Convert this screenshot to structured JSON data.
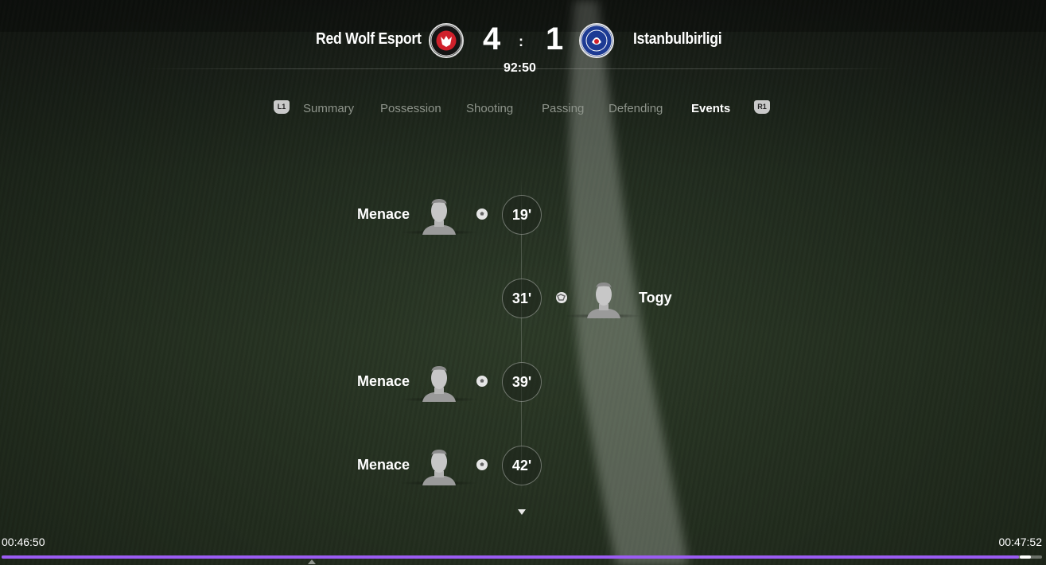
{
  "match": {
    "home_team": "Red Wolf Esport",
    "away_team": "Istanbulbirligi",
    "home_score": "4",
    "score_separator": ":",
    "away_score": "1",
    "clock": "92:50",
    "home_crest_icon": "red-wolf-crest-icon",
    "away_crest_icon": "chelsea-crest-icon"
  },
  "tabs": {
    "left_shoulder": "L1",
    "right_shoulder": "R1",
    "items": [
      {
        "label": "Summary",
        "active": false
      },
      {
        "label": "Possession",
        "active": false
      },
      {
        "label": "Shooting",
        "active": false
      },
      {
        "label": "Passing",
        "active": false
      },
      {
        "label": "Defending",
        "active": false
      },
      {
        "label": "Events",
        "active": true
      }
    ]
  },
  "events": [
    {
      "minute": "19'",
      "side": "home",
      "player": "Menace",
      "type": "goal"
    },
    {
      "minute": "31'",
      "side": "away",
      "player": "Togy",
      "type": "goal"
    },
    {
      "minute": "39'",
      "side": "home",
      "player": "Menace",
      "type": "goal"
    },
    {
      "minute": "42'",
      "side": "home",
      "player": "Menace",
      "type": "goal"
    }
  ],
  "video": {
    "current_time": "00:46:50",
    "end_time": "00:47:52",
    "progress_fraction": 0.978
  },
  "colors": {
    "accent_progress": "#9b5cf3",
    "home_crest": "#d0202b",
    "away_crest": "#1d3b94",
    "inactive_tab": "#8e948b"
  }
}
